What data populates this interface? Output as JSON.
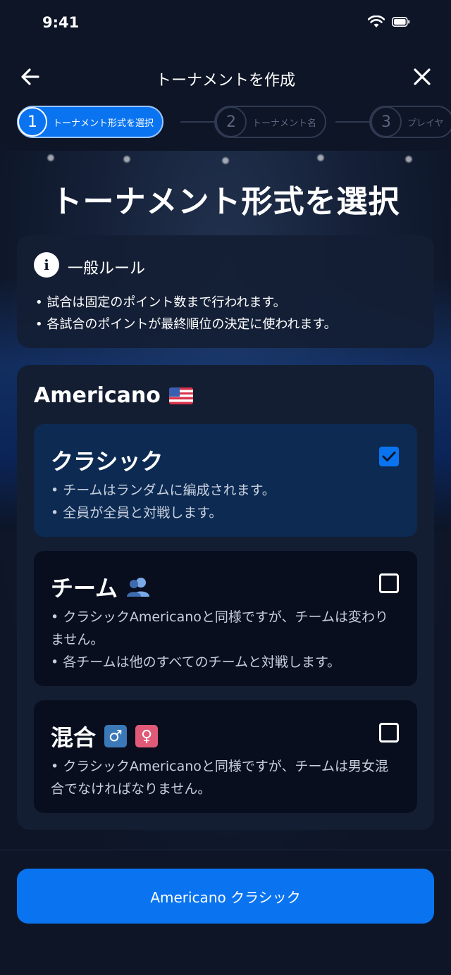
{
  "status": {
    "time": "9:41"
  },
  "nav": {
    "title": "トーナメントを作成"
  },
  "stepper": {
    "steps": [
      {
        "number": "1",
        "label": "トーナメント形式を選択"
      },
      {
        "number": "2",
        "label": "トーナメント名"
      },
      {
        "number": "3",
        "label": "プレイヤ"
      }
    ]
  },
  "hero": {
    "title": "トーナメント形式を選択"
  },
  "rules": {
    "title": "一般ルール",
    "items": [
      "• 試合は固定のポイント数まで行われます。",
      "• 各試合のポイントが最終順位の決定に使われます。"
    ]
  },
  "format": {
    "title": "Americano",
    "options": [
      {
        "name": "クラシック",
        "selected": true,
        "lines": [
          "• チームはランダムに編成されます。",
          "• 全員が全員と対戦します。"
        ]
      },
      {
        "name": "チーム",
        "selected": false,
        "lines": [
          "• クラシックAmericanoと同様ですが、チームは変わりません。",
          "• 各チームは他のすべてのチームと対戦します。"
        ]
      },
      {
        "name": "混合",
        "selected": false,
        "badges": [
          "♂",
          "♀"
        ],
        "lines": [
          "• クラシックAmericanoと同様ですが、チームは男女混合でなければなりません。"
        ]
      }
    ]
  },
  "footer": {
    "cta_label": "Americano クラシック"
  },
  "colors": {
    "accent": "#0a74f0",
    "background": "#0d1526",
    "selected_card": "#0c2a52"
  }
}
